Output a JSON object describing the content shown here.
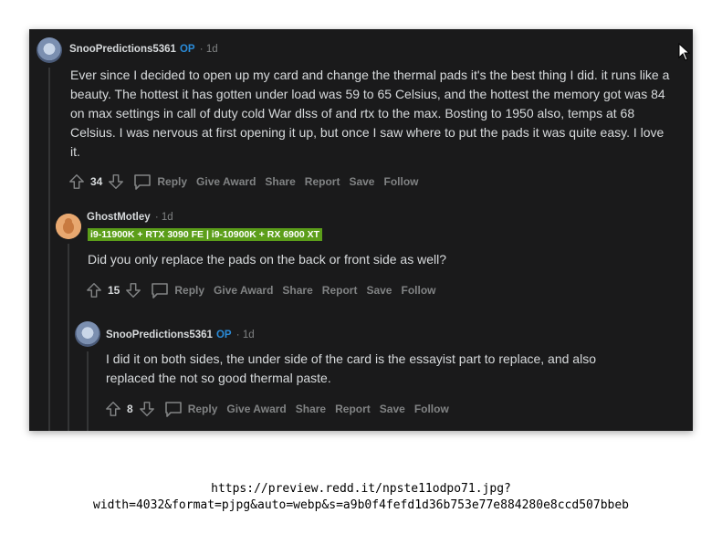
{
  "comments": [
    {
      "username": "SnooPredictions5361",
      "op_badge": "OP",
      "time": "· 1d",
      "body": "Ever since I decided to open up my card and change the thermal pads it's the best thing I did. it runs like a beauty. The hottest it has gotten under load was 59 to 65 Celsius, and the hottest the memory got was 84 on max settings in call of duty cold War dlss of and rtx to the max. Bosting to 1950 also, temps at 68 Celsius. I was nervous at first opening it up, but once I saw where to put the pads it was quite easy. I love it.",
      "votes": "34"
    },
    {
      "username": "GhostMotley",
      "time": "· 1d",
      "flair": "i9-11900K + RTX 3090 FE | i9-10900K + RX 6900 XT",
      "body": "Did you only replace the pads on the back or front side as well?",
      "votes": "15"
    },
    {
      "username": "SnooPredictions5361",
      "op_badge": "OP",
      "time": "· 1d",
      "body": "I did it on both sides, the under side of the card is the essayist part to replace, and also replaced the not so good thermal paste.",
      "votes": "8"
    }
  ],
  "actions": {
    "reply": "Reply",
    "give_award": "Give Award",
    "share": "Share",
    "report": "Report",
    "save": "Save",
    "follow": "Follow"
  },
  "caption": {
    "line1": "https://preview.redd.it/npste11odpo71.jpg?",
    "line2": "width=4032&format=pjpg&auto=webp&s=a9b0f4fefd1d36b753e77e884280e8ccd507bbeb"
  },
  "colors": {
    "background": "#1a1a1b",
    "text": "#d7dadc",
    "muted": "#818384",
    "op": "#2a8bd8",
    "flair": "#5c9e1a"
  }
}
